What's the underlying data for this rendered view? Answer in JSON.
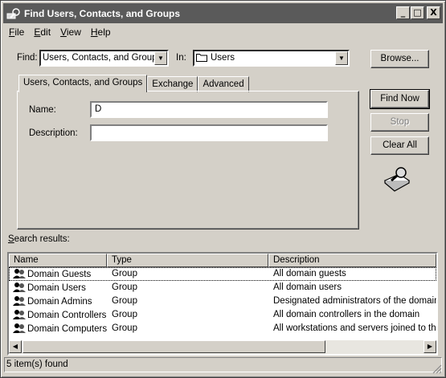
{
  "window": {
    "title": "Find Users, Contacts, and Groups",
    "controls": {
      "minimize": "_",
      "maximize": "□",
      "close": "X"
    }
  },
  "menu": [
    {
      "label": "File",
      "key": "F",
      "rest": "ile"
    },
    {
      "label": "Edit",
      "key": "E",
      "rest": "dit"
    },
    {
      "label": "View",
      "key": "V",
      "rest": "iew"
    },
    {
      "label": "Help",
      "key": "H",
      "rest": "elp"
    }
  ],
  "search": {
    "find_label": "Find:",
    "find_value": "Users, Contacts, and Groups",
    "in_label": "In:",
    "in_value": "Users",
    "browse_button": "Browse..."
  },
  "tabs": [
    {
      "label": "Users, Contacts, and Groups",
      "active": true
    },
    {
      "label": "Exchange",
      "active": false
    },
    {
      "label": "Advanced",
      "active": false
    }
  ],
  "form": {
    "name_label": "Name:",
    "name_value": "D",
    "description_label": "Description:",
    "description_value": ""
  },
  "actions": {
    "find_now": "Find Now",
    "stop": "Stop",
    "clear_all": "Clear All"
  },
  "results": {
    "label": "Search results:",
    "columns": [
      "Name",
      "Type",
      "Description"
    ],
    "rows": [
      {
        "name": "Domain Guests",
        "type": "Group",
        "description": "All domain guests"
      },
      {
        "name": "Domain Users",
        "type": "Group",
        "description": "All domain users"
      },
      {
        "name": "Domain Admins",
        "type": "Group",
        "description": "Designated administrators of the domain"
      },
      {
        "name": "Domain Controllers",
        "type": "Group",
        "description": "All domain controllers in the domain"
      },
      {
        "name": "Domain Computers",
        "type": "Group",
        "description": "All workstations and servers joined to the"
      }
    ]
  },
  "status": {
    "text": "5 item(s) found"
  },
  "icons": {
    "title": "find-users-icon",
    "folder": "folder-icon",
    "group": "group-icon",
    "search_animation": "magnifier-icon"
  }
}
